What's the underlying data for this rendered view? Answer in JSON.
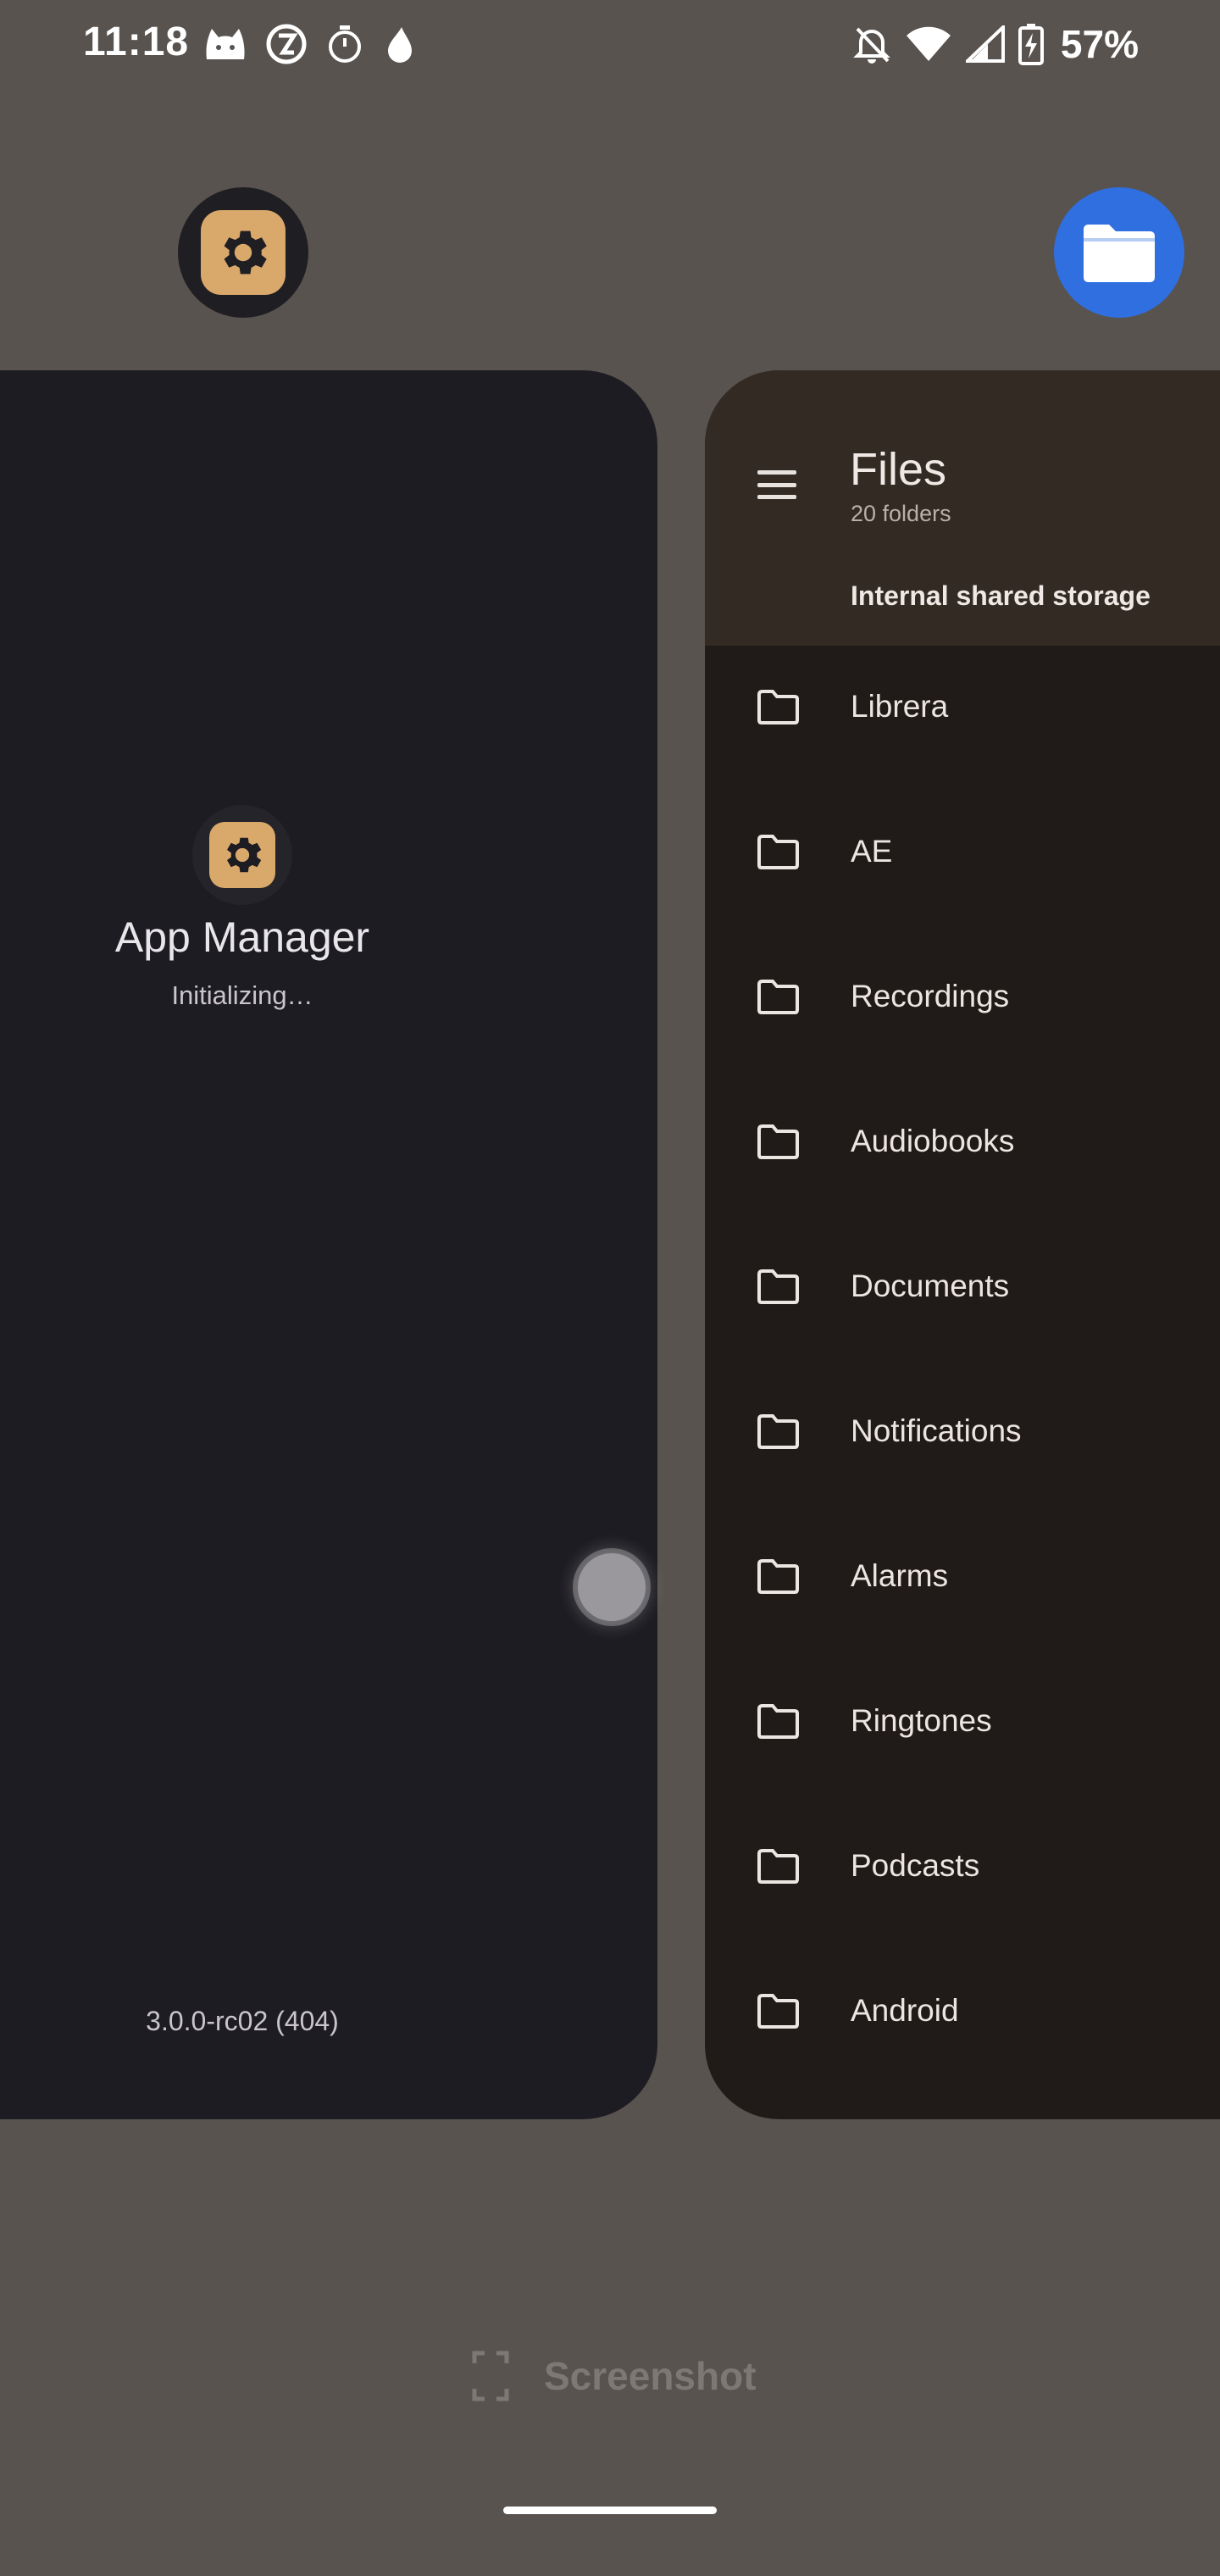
{
  "status_bar": {
    "time": "11:18",
    "battery": "57%",
    "left_icons": [
      "cat-notification-icon",
      "app-notification-icon",
      "stopwatch-icon",
      "drop-icon"
    ],
    "right_icons": [
      "bell-off-icon",
      "wifi-icon",
      "signal-icon",
      "battery-charging-icon"
    ]
  },
  "recents": {
    "app_manager": {
      "title": "App Manager",
      "status": "Initializing…",
      "version": "3.0.0-rc02 (404)",
      "icon": "gear-icon",
      "accent_color": "#d9a86b"
    },
    "files": {
      "title": "Files",
      "subtitle": "20 folders",
      "location": "Internal shared storage",
      "icon": "folder-icon",
      "accent_color": "#2f6fe0",
      "folders": [
        {
          "name": "Librera"
        },
        {
          "name": "AE"
        },
        {
          "name": "Recordings"
        },
        {
          "name": "Audiobooks"
        },
        {
          "name": "Documents"
        },
        {
          "name": "Notifications"
        },
        {
          "name": "Alarms"
        },
        {
          "name": "Ringtones"
        },
        {
          "name": "Podcasts"
        },
        {
          "name": "Android"
        }
      ]
    }
  },
  "actions": {
    "screenshot_label": "Screenshot"
  }
}
